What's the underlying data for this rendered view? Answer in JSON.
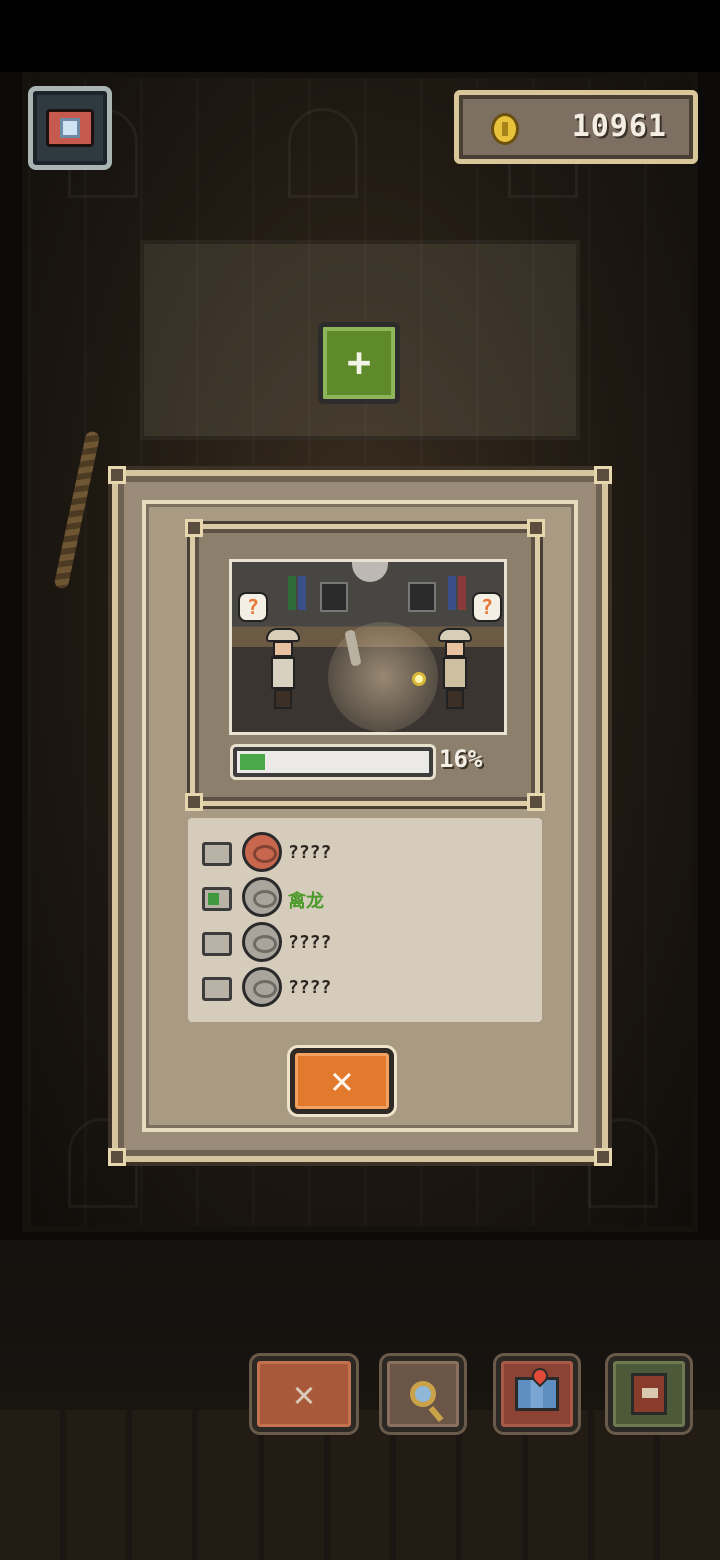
{
  "hud": {
    "coins": "10961",
    "add_label": "+"
  },
  "dialog": {
    "progress": {
      "percent_label": "16%",
      "fraction": 0.16
    },
    "fossils": [
      {
        "name": "????",
        "checked": false,
        "icon_color": "#c8674e"
      },
      {
        "name": "禽龙",
        "checked": true,
        "icon_color": "#a9a59c"
      },
      {
        "name": "????",
        "checked": false,
        "icon_color": "#a9a59c"
      },
      {
        "name": "????",
        "checked": false,
        "icon_color": "#a9a59c"
      }
    ],
    "close_label": "✕",
    "scene_bubbles": [
      "?",
      "?"
    ]
  },
  "toolbar": {
    "cancel_label": "✕"
  },
  "colors": {
    "accent_orange": "#e27a2e",
    "progress_green": "#4aa84a",
    "found_text": "#4b9a2c"
  }
}
